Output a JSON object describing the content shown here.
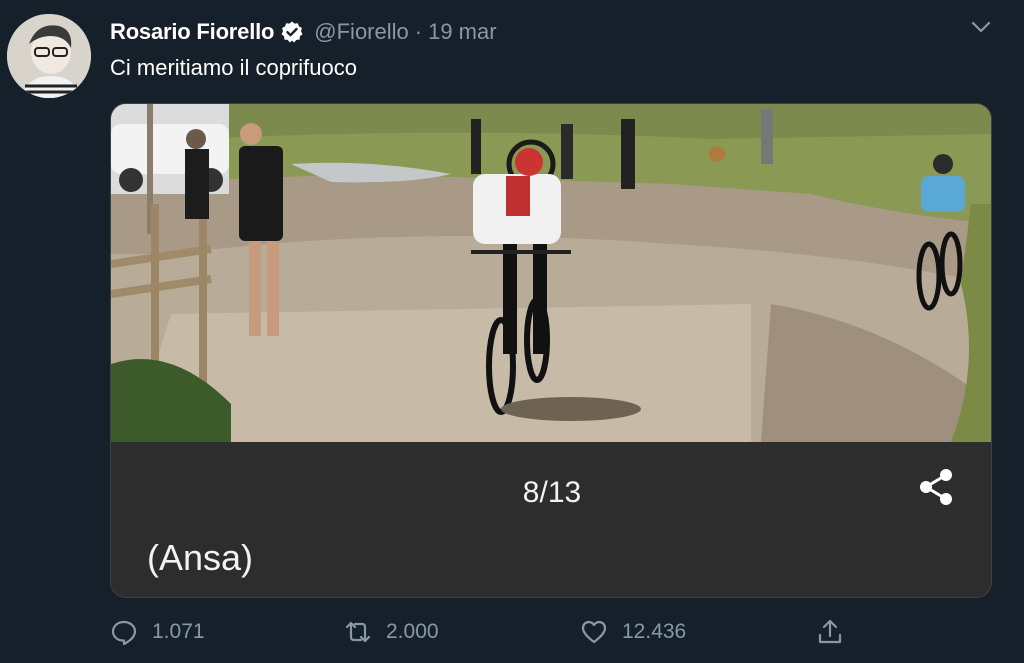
{
  "tweet": {
    "author_name": "Rosario Fiorello",
    "handle": "@Fiorello",
    "separator": "·",
    "date": "19 mar",
    "text": "Ci meritiamo il coprifuoco"
  },
  "media": {
    "counter": "8/13",
    "caption": "(Ansa)"
  },
  "actions": {
    "replies": "1.071",
    "retweets": "2.000",
    "likes": "12.436"
  },
  "icons": {
    "verified": "verified-badge-icon",
    "menu": "chevron-down-icon",
    "share_media": "share-icon",
    "reply": "reply-icon",
    "retweet": "retweet-icon",
    "like": "heart-icon",
    "share_tweet": "upload-icon"
  },
  "colors": {
    "background": "#15202b",
    "secondary_text": "#8899a6",
    "primary_text": "#ffffff",
    "caption_panel": "#2d2d2d"
  }
}
